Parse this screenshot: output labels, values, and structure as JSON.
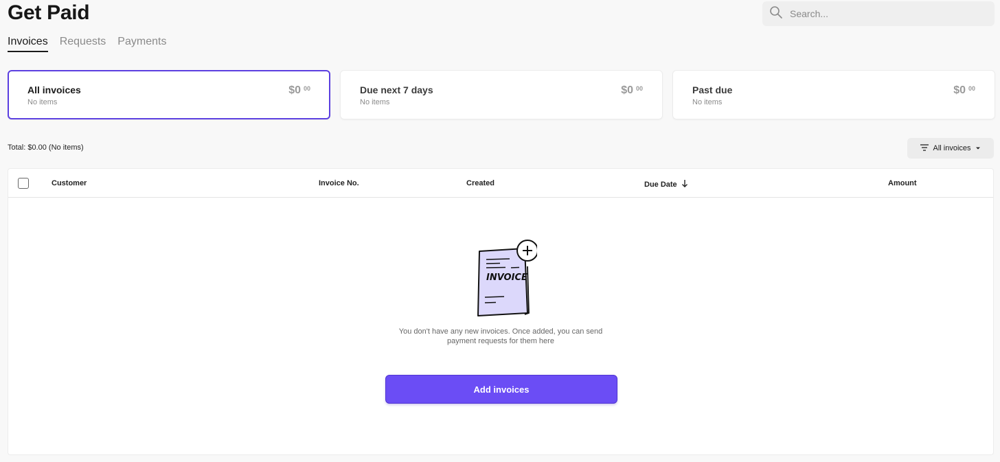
{
  "header": {
    "title": "Get Paid",
    "search_placeholder": "Search..."
  },
  "tabs": [
    {
      "label": "Invoices",
      "active": true
    },
    {
      "label": "Requests",
      "active": false
    },
    {
      "label": "Payments",
      "active": false
    }
  ],
  "summary_cards": [
    {
      "title": "All invoices",
      "subtitle": "No items",
      "amount": "$0",
      "cents": "00",
      "active": true
    },
    {
      "title": "Due next 7 days",
      "subtitle": "No items",
      "amount": "$0",
      "cents": "00",
      "active": false
    },
    {
      "title": "Past due",
      "subtitle": "No items",
      "amount": "$0",
      "cents": "00",
      "active": false
    }
  ],
  "total_text": "Total: $0.00 (No items)",
  "filter": {
    "label": "All invoices"
  },
  "table": {
    "columns": [
      "Customer",
      "Invoice No.",
      "Created",
      "Due Date",
      "Amount"
    ],
    "sorted_column": "Due Date"
  },
  "empty_state": {
    "illustration_text": "INVOICE",
    "message_line1": "You don't have any new invoices. Once added, you can send",
    "message_line2": "payment requests for them here",
    "button_label": "Add invoices"
  },
  "colors": {
    "accent": "#6b4df5",
    "active_border": "#5b3fe0",
    "illustration_fill": "#dcd8fb"
  }
}
